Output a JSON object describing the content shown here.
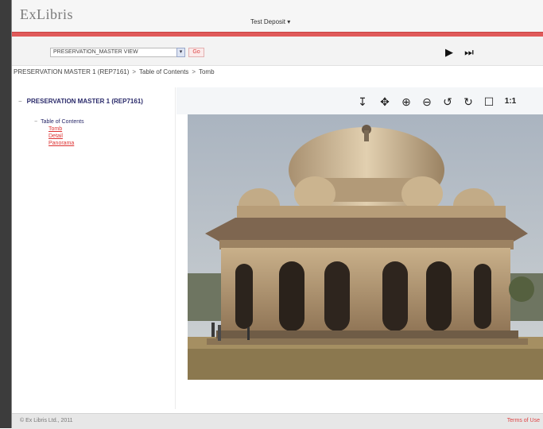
{
  "app": {
    "logo_text": "ExLibris",
    "deposit_menu": "Test Deposit ▾"
  },
  "toolbar": {
    "representation_select": "PRESERVATION_MASTER VIEW",
    "go_label": "Go",
    "next_icon": "play-icon",
    "last_icon": "skip-forward-icon"
  },
  "breadcrumb": {
    "items": [
      "PRESERVATION MASTER 1 (REP7161)",
      "Table of Contents",
      "Tomb"
    ]
  },
  "tree": {
    "root_label": "PRESERVATION MASTER 1 (REP7161)",
    "toc_label": "Table of Contents",
    "children": [
      "Tomb",
      "Detail",
      "Panorama"
    ]
  },
  "viewer": {
    "tools": [
      {
        "icon": "download-icon",
        "glyph": "↧"
      },
      {
        "icon": "pan-icon",
        "glyph": "✥"
      },
      {
        "icon": "zoom-in-icon",
        "glyph": "⊕"
      },
      {
        "icon": "zoom-out-icon",
        "glyph": "⊖"
      },
      {
        "icon": "rotate-left-icon",
        "glyph": "↺"
      },
      {
        "icon": "rotate-right-icon",
        "glyph": "↻"
      },
      {
        "icon": "fit-page-icon",
        "glyph": "☐"
      }
    ],
    "actual_size_label": "1:1"
  },
  "footer": {
    "copyright": "© Ex Libris Ltd., 2011",
    "link": "Terms of Use"
  },
  "colors": {
    "accent_red": "#e05a5a",
    "link_red": "#d33333",
    "tree_navy": "#2a2a6a"
  }
}
